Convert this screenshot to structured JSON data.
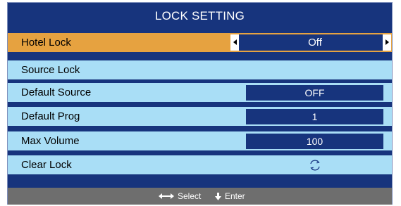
{
  "menu": {
    "title": "LOCK SETTING",
    "items": [
      {
        "label": "Hotel Lock",
        "value": "Off",
        "selected": true
      },
      {
        "label": "Source Lock"
      },
      {
        "label": "Default Source",
        "value": "OFF"
      },
      {
        "label": "Default Prog",
        "value": "1"
      },
      {
        "label": "Max Volume",
        "value": "100"
      },
      {
        "label": "Clear Lock",
        "icon": "reset-icon"
      }
    ]
  },
  "footer": {
    "select_label": "Select",
    "enter_label": "Enter"
  },
  "colors": {
    "panel": "#17347d",
    "row": "#a9def6",
    "selected_row": "#e6a240",
    "footer": "#6e6e6e"
  }
}
